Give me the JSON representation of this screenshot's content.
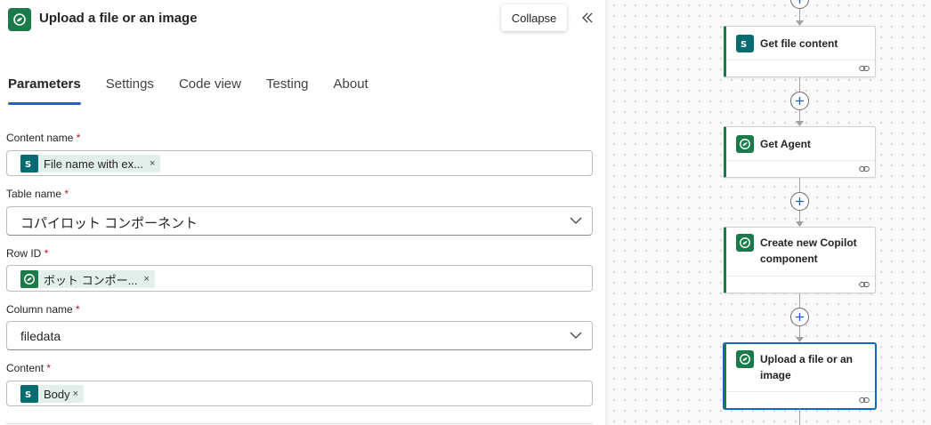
{
  "panel": {
    "title": "Upload a file or an image",
    "collapse_tooltip": "Collapse",
    "tabs": [
      {
        "label": "Parameters",
        "active": true
      },
      {
        "label": "Settings",
        "active": false
      },
      {
        "label": "Code view",
        "active": false
      },
      {
        "label": "Testing",
        "active": false
      },
      {
        "label": "About",
        "active": false
      }
    ],
    "fields": {
      "content_name": {
        "label": "Content name",
        "required": "*",
        "token": "File name with ex...",
        "token_remove": "×",
        "token_icon": "sharepoint-icon"
      },
      "table_name": {
        "label": "Table name",
        "required": "*",
        "value": "コパイロット コンポーネント"
      },
      "row_id": {
        "label": "Row ID",
        "required": "*",
        "token": "ボット コンポー...",
        "token_remove": "×",
        "token_icon": "dataverse-icon"
      },
      "column_name": {
        "label": "Column name",
        "required": "*",
        "value": "filedata"
      },
      "content": {
        "label": "Content",
        "required": "*",
        "token": "Body",
        "token_remove": "×",
        "token_icon": "sharepoint-icon"
      }
    }
  },
  "canvas": {
    "cards": [
      {
        "title": "Get file content",
        "icon": "sharepoint-icon",
        "selected": false
      },
      {
        "title": "Get Agent",
        "icon": "dataverse-icon",
        "selected": false
      },
      {
        "title": "Create new Copilot component",
        "icon": "dataverse-icon",
        "selected": false
      },
      {
        "title": "Upload a file or an image",
        "icon": "dataverse-icon",
        "selected": true
      }
    ]
  },
  "colors": {
    "accent_tab": "#2b5bd6",
    "dataverse": "#1b7a4a",
    "sharepoint": "#036c70",
    "selected_border": "#1765c2",
    "required": "#c50f1f"
  }
}
